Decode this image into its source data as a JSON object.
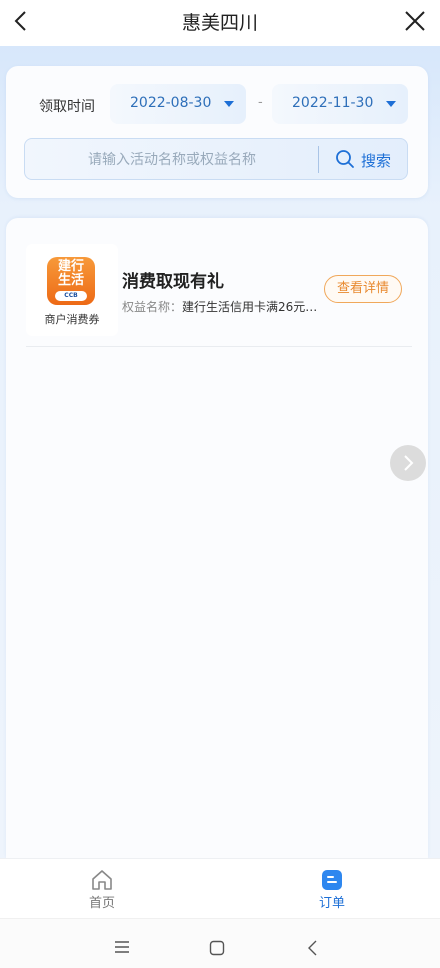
{
  "header": {
    "title": "惠美四川",
    "back_icon": "back-chevron-icon",
    "close_icon": "close-x-icon"
  },
  "filter": {
    "label": "领取时间",
    "start_date": "2022-08-30",
    "end_date": "2022-11-30",
    "separator": "-",
    "search_placeholder": "请输入活动名称或权益名称",
    "search_value": "",
    "search_button": "搜索"
  },
  "orders": [
    {
      "logo_line1": "建行",
      "logo_line2": "生活",
      "logo_badge": "CCB",
      "logo_caption": "商户消费券",
      "title": "消费取现有礼",
      "benefit_key": "权益名称：",
      "benefit_value": "建行生活信用卡满26元…",
      "detail_button": "查看详情"
    }
  ],
  "tabbar": {
    "items": [
      {
        "label": "首页",
        "icon": "home-icon",
        "active": false
      },
      {
        "label": "订单",
        "icon": "order-icon",
        "active": true
      }
    ]
  },
  "colors": {
    "accent": "#1d6fd6",
    "orange": "#e8892f",
    "tab_active": "#1d6fd6",
    "tab_inactive": "#777777"
  }
}
